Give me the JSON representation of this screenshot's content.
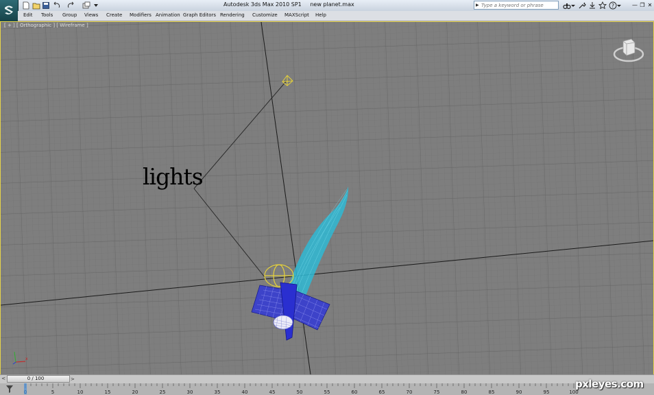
{
  "titlebar": {
    "app_name": "Autodesk 3ds Max  2010 SP1",
    "file_name": "new planet.max",
    "search_placeholder": "Type a keyword or phrase"
  },
  "menu": [
    "Edit",
    "Tools",
    "Group",
    "Views",
    "Create",
    "Modifiers",
    "Animation",
    "Graph Editors",
    "Rendering",
    "Customize",
    "MAXScript",
    "Help"
  ],
  "viewport": {
    "label": "[ + ] [ Orthographic ] [ Wireframe ]",
    "annotation": "lights",
    "active_border_color": "#e7d44a",
    "background_color": "#7e7e7e"
  },
  "timeline": {
    "slider_label": "0 / 100",
    "prev_icon": "arrow-left-icon",
    "next_icon": "arrow-right-icon"
  },
  "trackbar": {
    "ticks": [
      "0",
      "5",
      "10",
      "15",
      "20",
      "25",
      "30",
      "35",
      "40",
      "45",
      "50",
      "55",
      "60",
      "65",
      "70",
      "75",
      "80",
      "85",
      "90",
      "95",
      "100"
    ]
  },
  "watermark": "pxleyes.com",
  "icons": [
    "3dsmax-logo-icon",
    "new-file-icon",
    "open-file-icon",
    "save-icon",
    "undo-icon",
    "redo-icon",
    "project-folder-icon",
    "binoculars-icon",
    "communication-center-icon",
    "favorites-star-icon",
    "help-icon",
    "minimize-icon",
    "restore-icon",
    "close-icon",
    "viewcube-icon",
    "axis-tripod-icon",
    "filter-icon"
  ]
}
